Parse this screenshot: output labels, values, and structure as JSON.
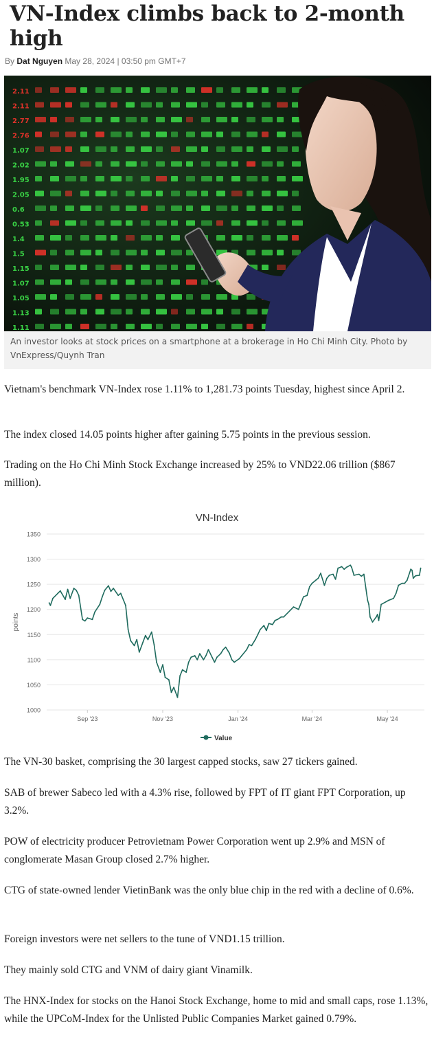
{
  "article": {
    "headline": "VN-Index climbs back to 2-month high",
    "by_prefix": "By",
    "author": "Dat Nguyen",
    "date": "May 28, 2024 | 03:50 pm GMT+7",
    "image_caption": "An investor looks at stock prices on a smartphone at a brokerage in Ho Chi Minh City. Photo by VnExpress/Quynh Tran",
    "paragraphs": [
      "Vietnam's benchmark VN-Index rose 1.11% to 1,281.73 points Tuesday, highest since April 2.",
      "The index closed 14.05 points higher after gaining 5.75 points in the previous session.",
      "Trading on the Ho Chi Minh Stock Exchange increased by 25% to VND22.06 trillion ($867 million).",
      "The VN-30 basket, comprising the 30 largest capped stocks, saw 27 tickers gained.",
      "SAB of brewer Sabeco led with a 4.3% rise, followed by FPT of IT giant FPT Corporation, up 3.2%.",
      "POW of electricity producer Petrovietnam Power Corporation went up 2.9% and MSN of conglomerate Masan Group closed 2.7% higher.",
      "CTG of state-owned lender VietinBank was the only blue chip in the red with a decline of 0.6%.",
      "Foreign investors were net sellers to the tune of VND1.15 trillion.",
      "They mainly sold CTG and VNM of dairy giant Vinamilk.",
      "The HNX-Index for stocks on the Hanoi Stock Exchange, home to mid and small caps, rose 1.13%, while the UPCoM-Index for the Unlisted Public Companies Market gained 0.79%."
    ]
  },
  "photo_board_numbers": [
    "2.11",
    "2.11",
    "2.77",
    "2.76",
    "1.07",
    "2.02",
    "1.95",
    "2.05",
    "0.6",
    "0.53",
    "1.4",
    "1.5",
    "1.15",
    "1.07",
    "1.05",
    "1.13",
    "1.11"
  ],
  "colors": {
    "line": "#1f6b5e",
    "grid": "#e6e6e6",
    "axis_text": "#666666",
    "board_green": "#39d245",
    "board_red": "#e0322a",
    "jacket": "#23285a"
  },
  "chart_data": {
    "type": "line",
    "title": "VN-Index",
    "xlabel": "",
    "ylabel": "points",
    "ylim": [
      1000,
      1350
    ],
    "yticks": [
      "1350",
      "1300",
      "1250",
      "1200",
      "1150",
      "1100",
      "1050",
      "1000"
    ],
    "xticks": [
      "Sep '23",
      "Nov '23",
      "Jan '24",
      "Mar '24",
      "May '24"
    ],
    "grid": true,
    "legend_position": "bottom",
    "series": [
      {
        "name": "Value",
        "points": [
          [
            "2023-08-01",
            1213
          ],
          [
            "2023-08-02",
            1208
          ],
          [
            "2023-08-04",
            1222
          ],
          [
            "2023-08-08",
            1232
          ],
          [
            "2023-08-10",
            1237
          ],
          [
            "2023-08-14",
            1220
          ],
          [
            "2023-08-16",
            1240
          ],
          [
            "2023-08-18",
            1222
          ],
          [
            "2023-08-21",
            1242
          ],
          [
            "2023-08-23",
            1238
          ],
          [
            "2023-08-25",
            1228
          ],
          [
            "2023-08-28",
            1180
          ],
          [
            "2023-08-30",
            1177
          ],
          [
            "2023-09-01",
            1183
          ],
          [
            "2023-09-05",
            1180
          ],
          [
            "2023-09-07",
            1195
          ],
          [
            "2023-09-11",
            1210
          ],
          [
            "2023-09-13",
            1225
          ],
          [
            "2023-09-15",
            1238
          ],
          [
            "2023-09-18",
            1247
          ],
          [
            "2023-09-20",
            1236
          ],
          [
            "2023-09-22",
            1242
          ],
          [
            "2023-09-26",
            1228
          ],
          [
            "2023-09-28",
            1232
          ],
          [
            "2023-10-02",
            1208
          ],
          [
            "2023-10-04",
            1160
          ],
          [
            "2023-10-06",
            1138
          ],
          [
            "2023-10-09",
            1128
          ],
          [
            "2023-10-11",
            1140
          ],
          [
            "2023-10-13",
            1115
          ],
          [
            "2023-10-16",
            1135
          ],
          [
            "2023-10-18",
            1148
          ],
          [
            "2023-10-20",
            1140
          ],
          [
            "2023-10-23",
            1155
          ],
          [
            "2023-10-25",
            1130
          ],
          [
            "2023-10-27",
            1095
          ],
          [
            "2023-10-30",
            1075
          ],
          [
            "2023-11-01",
            1090
          ],
          [
            "2023-11-03",
            1065
          ],
          [
            "2023-11-06",
            1060
          ],
          [
            "2023-11-08",
            1035
          ],
          [
            "2023-11-10",
            1045
          ],
          [
            "2023-11-13",
            1025
          ],
          [
            "2023-11-15",
            1068
          ],
          [
            "2023-11-17",
            1080
          ],
          [
            "2023-11-20",
            1075
          ],
          [
            "2023-11-22",
            1095
          ],
          [
            "2023-11-24",
            1105
          ],
          [
            "2023-11-27",
            1108
          ],
          [
            "2023-11-29",
            1100
          ],
          [
            "2023-12-01",
            1112
          ],
          [
            "2023-12-04",
            1100
          ],
          [
            "2023-12-06",
            1108
          ],
          [
            "2023-12-08",
            1120
          ],
          [
            "2023-12-11",
            1105
          ],
          [
            "2023-12-13",
            1095
          ],
          [
            "2023-12-15",
            1105
          ],
          [
            "2023-12-18",
            1112
          ],
          [
            "2023-12-20",
            1120
          ],
          [
            "2023-12-22",
            1125
          ],
          [
            "2023-12-25",
            1113
          ],
          [
            "2023-12-27",
            1100
          ],
          [
            "2023-12-29",
            1095
          ],
          [
            "2024-01-02",
            1102
          ],
          [
            "2024-01-04",
            1108
          ],
          [
            "2024-01-08",
            1120
          ],
          [
            "2024-01-10",
            1130
          ],
          [
            "2024-01-12",
            1128
          ],
          [
            "2024-01-15",
            1140
          ],
          [
            "2024-01-17",
            1150
          ],
          [
            "2024-01-19",
            1160
          ],
          [
            "2024-01-22",
            1168
          ],
          [
            "2024-01-24",
            1158
          ],
          [
            "2024-01-26",
            1172
          ],
          [
            "2024-01-29",
            1170
          ],
          [
            "2024-01-31",
            1178
          ],
          [
            "2024-02-02",
            1180
          ],
          [
            "2024-02-05",
            1185
          ],
          [
            "2024-02-07",
            1185
          ],
          [
            "2024-02-15",
            1205
          ],
          [
            "2024-02-19",
            1200
          ],
          [
            "2024-02-21",
            1212
          ],
          [
            "2024-02-23",
            1225
          ],
          [
            "2024-02-26",
            1228
          ],
          [
            "2024-02-28",
            1245
          ],
          [
            "2024-03-01",
            1252
          ],
          [
            "2024-03-04",
            1258
          ],
          [
            "2024-03-06",
            1262
          ],
          [
            "2024-03-08",
            1272
          ],
          [
            "2024-03-11",
            1248
          ],
          [
            "2024-03-13",
            1262
          ],
          [
            "2024-03-15",
            1268
          ],
          [
            "2024-03-18",
            1270
          ],
          [
            "2024-03-20",
            1260
          ],
          [
            "2024-03-22",
            1282
          ],
          [
            "2024-03-25",
            1285
          ],
          [
            "2024-03-27",
            1280
          ],
          [
            "2024-03-29",
            1284
          ],
          [
            "2024-04-01",
            1288
          ],
          [
            "2024-04-02",
            1284
          ],
          [
            "2024-04-04",
            1268
          ],
          [
            "2024-04-08",
            1270
          ],
          [
            "2024-04-10",
            1266
          ],
          [
            "2024-04-12",
            1270
          ],
          [
            "2024-04-15",
            1218
          ],
          [
            "2024-04-16",
            1210
          ],
          [
            "2024-04-17",
            1185
          ],
          [
            "2024-04-19",
            1175
          ],
          [
            "2024-04-22",
            1185
          ],
          [
            "2024-04-23",
            1190
          ],
          [
            "2024-04-24",
            1178
          ],
          [
            "2024-04-26",
            1210
          ],
          [
            "2024-05-02",
            1218
          ],
          [
            "2024-05-06",
            1222
          ],
          [
            "2024-05-08",
            1232
          ],
          [
            "2024-05-10",
            1248
          ],
          [
            "2024-05-13",
            1252
          ],
          [
            "2024-05-15",
            1252
          ],
          [
            "2024-05-17",
            1258
          ],
          [
            "2024-05-20",
            1280
          ],
          [
            "2024-05-21",
            1278
          ],
          [
            "2024-05-22",
            1262
          ],
          [
            "2024-05-23",
            1265
          ],
          [
            "2024-05-24",
            1267
          ],
          [
            "2024-05-27",
            1268
          ],
          [
            "2024-05-28",
            1282
          ]
        ]
      }
    ]
  }
}
